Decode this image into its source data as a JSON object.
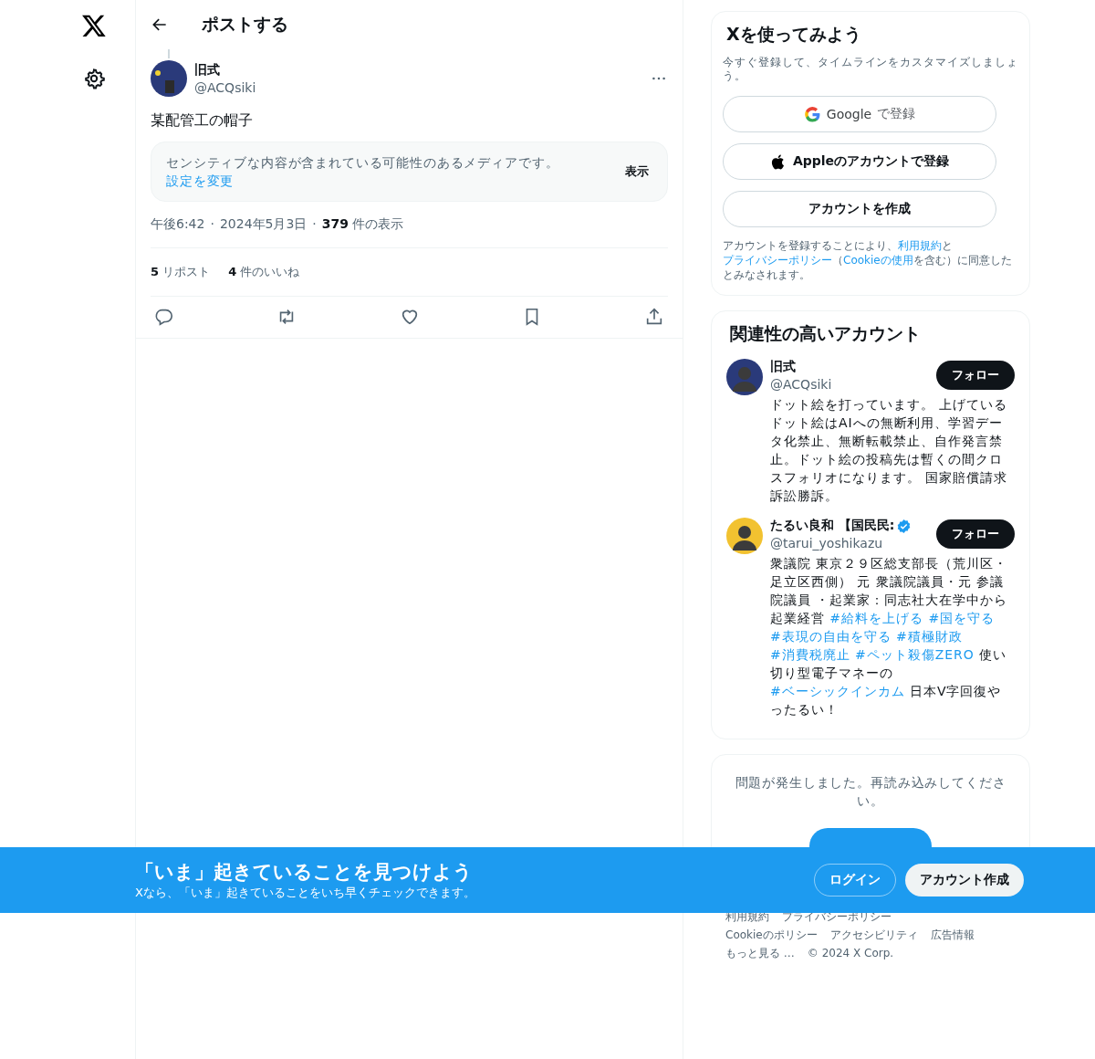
{
  "header": {
    "title": "ポストする"
  },
  "post": {
    "name": "旧式",
    "handle": "@ACQsiki",
    "text": "某配管工の帽子",
    "sensitive": {
      "message": "センシティブな内容が含まれている可能性のあるメディアです。",
      "link": "設定を変更",
      "action": "表示"
    },
    "meta": {
      "time": "午後6:42",
      "separators": [
        "·",
        "·"
      ],
      "date": "2024年5月3日",
      "views_count": "379",
      "views_label": "件の表示"
    },
    "stats": [
      {
        "count": "5",
        "label": "リポスト"
      },
      {
        "count": "4",
        "label": "件のいいね"
      }
    ],
    "actions": [
      {
        "kind": "reply"
      },
      {
        "kind": "repost"
      },
      {
        "kind": "like"
      },
      {
        "kind": "bookmark"
      },
      {
        "kind": "share"
      }
    ]
  },
  "signup": {
    "title": "Xを使ってみよう",
    "subtitle": "今すぐ登録して、タイムラインをカスタマイズしましょう。",
    "buttons": [
      {
        "kind": "google",
        "brand": "Google",
        "label": "で登録"
      },
      {
        "kind": "apple",
        "label": "Appleのアカウントで登録"
      },
      {
        "kind": "plain",
        "label": "アカウントを作成"
      }
    ],
    "legal": [
      {
        "kind": "text",
        "text": "アカウントを登録することにより、"
      },
      {
        "kind": "link",
        "text": "利用規約"
      },
      {
        "kind": "text",
        "text": "と"
      },
      {
        "kind": "link",
        "text": "プライバシーポリシー"
      },
      {
        "kind": "text",
        "text": "（"
      },
      {
        "kind": "link",
        "text": "Cookieの使用"
      },
      {
        "kind": "text",
        "text": "を含む）に同意したとみなされます。"
      }
    ]
  },
  "relevant": {
    "title": "関連性の高いアカウント",
    "accounts": [
      {
        "name": "旧式",
        "verified": false,
        "handle": "@ACQsiki",
        "color": "#2a3a7a",
        "follow_label": "フォロー",
        "bio": [
          {
            "kind": "text",
            "text": "ドット絵を打っています。 上げているドット絵はAIへの無断利用、学習データ化禁止、無断転載禁止、自作発言禁止。ドット絵の投稿先は暫くの間クロスフォリオになります。 国家賠償請求訴訟勝訴。"
          }
        ]
      },
      {
        "name": "たるい良和 【国民民:",
        "verified": true,
        "handle": "@tarui_yoshikazu",
        "color": "#f2c230",
        "follow_label": "フォロー",
        "bio": [
          {
            "kind": "text",
            "text": "衆議院 東京２９区総支部長（荒川区・足立区西側） 元 衆議院議員・元 参議院議員 ・起業家：同志社大在学中から起業経営"
          },
          {
            "kind": "link",
            "text": "#給料を上げる"
          },
          {
            "kind": "link",
            "text": "#国を守る"
          },
          {
            "kind": "link",
            "text": "#表現の自由を守る"
          },
          {
            "kind": "link",
            "text": "#積極財政"
          },
          {
            "kind": "link",
            "text": "#消費税廃止"
          },
          {
            "kind": "link",
            "text": "#ペット殺傷ZERO"
          },
          {
            "kind": "text",
            "text": "使い切り型電子マネーの"
          },
          {
            "kind": "link",
            "text": "#ベーシックインカム"
          },
          {
            "kind": "text",
            "text": "日本V字回復やったるい！"
          }
        ]
      }
    ]
  },
  "error_card": {
    "message": "問題が発生しました。再読み込みしてください。"
  },
  "footer": {
    "rows": [
      [
        "利用規約",
        "プライバシーポリシー"
      ],
      [
        "Cookieのポリシー",
        "アクセシビリティ",
        "広告情報"
      ],
      [
        "もっと見る …",
        "© 2024 X Corp."
      ]
    ]
  },
  "banner": {
    "title": "「いま」起きていることを見つけよう",
    "subtitle": "Xなら、「いま」起きていることをいち早くチェックできます。",
    "login": "ログイン",
    "signup": "アカウント作成"
  }
}
